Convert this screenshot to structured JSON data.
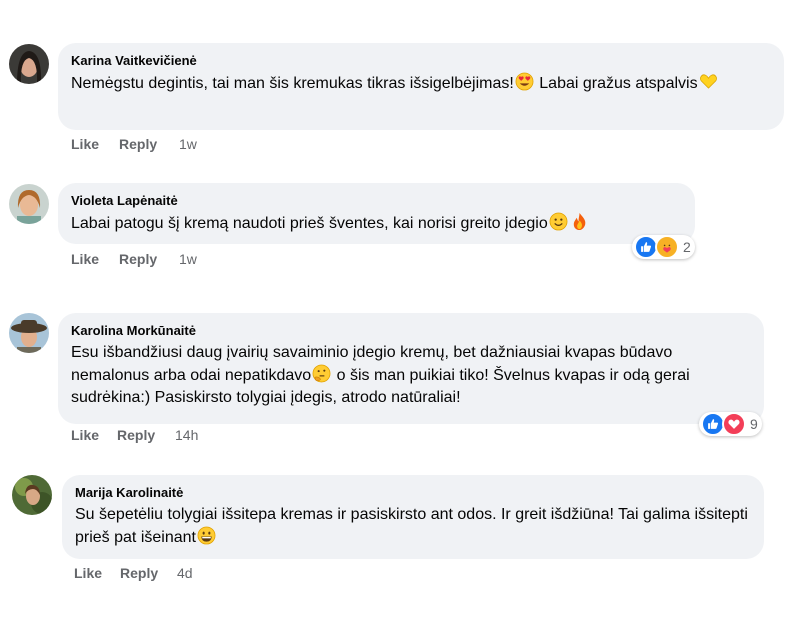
{
  "comments": [
    {
      "author": "Karina Vaitkevičienė",
      "text_parts": [
        "Nemėgstu degintis, tai man šis kremukas tikras išsigelbėjimas!",
        " Labai gražus atspalvis"
      ],
      "emoji": [
        "heart-eyes-emoji",
        "yellow-heart-emoji"
      ],
      "like": "Like",
      "reply": "Reply",
      "time": "1w"
    },
    {
      "author": "Violeta Lapėnaitė",
      "text_parts": [
        "Labai patogu šį kremą naudoti prieš šventes, kai norisi greito įdegio"
      ],
      "emoji": [
        "smiling-face-emoji",
        "fire-emoji"
      ],
      "like": "Like",
      "reply": "Reply",
      "time": "1w",
      "reactions": {
        "types": [
          "like",
          "care"
        ],
        "count": "2"
      }
    },
    {
      "author": "Karolina Morkūnaitė",
      "text_parts": [
        "Esu išbandžiusi daug įvairių savaiminio įdegio kremų, bet dažniausiai kvapas būdavo nemalonus arba odai nepatikdavo",
        " o šis man puikiai tiko! Švelnus kvapas ir odą gerai sudrėkina:) Pasiskirsto tolygiai įdegis, atrodo natūraliai!"
      ],
      "emoji": [
        "thinking-face-emoji"
      ],
      "like": "Like",
      "reply": "Reply",
      "time": "14h",
      "reactions": {
        "types": [
          "like",
          "love"
        ],
        "count": "9"
      }
    },
    {
      "author": "Marija Karolinaitė",
      "text_parts": [
        "Su šepetėliu tolygiai išsitepa kremas ir pasiskirsto ant odos. Ir greit išdžiūna! Tai galima išsitepti prieš pat išeinant"
      ],
      "emoji": [
        "grinning-face-emoji"
      ],
      "like": "Like",
      "reply": "Reply",
      "time": "4d"
    }
  ],
  "colors": {
    "bubble": "#f0f2f5",
    "meta": "#65676b",
    "like_blue": "#1877f2",
    "love_red": "#f33e58"
  }
}
